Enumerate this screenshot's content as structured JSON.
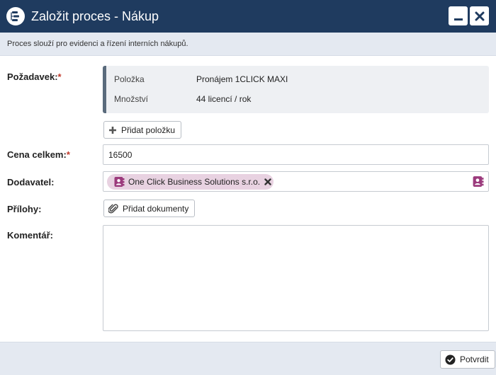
{
  "window": {
    "title": "Založit proces - Nákup",
    "icons": {
      "app": "process-icon",
      "minimize": "minimize-icon",
      "close": "close-icon"
    }
  },
  "description": "Proces slouží pro evidenci a řízení interních nákupů.",
  "form": {
    "pozadavek": {
      "label": "Požadavek:",
      "required_mark": "*",
      "rows": [
        {
          "key": "Položka",
          "value": "Pronájem 1CLICK MAXI"
        },
        {
          "key": "Množství",
          "value": "44 licencí / rok"
        }
      ],
      "add_item_button": "Přidat položku"
    },
    "cena": {
      "label": "Cena celkem:",
      "required_mark": "*",
      "value": "16500"
    },
    "dodavatel": {
      "label": "Dodavatel:",
      "chip_label": "One Click Business Solutions s.r.o."
    },
    "prilohy": {
      "label": "Přílohy:",
      "add_documents_button": "Přidat dokumenty"
    },
    "komentar": {
      "label": "Komentář:",
      "value": ""
    }
  },
  "footer": {
    "confirm_button": "Potvrdit"
  },
  "colors": {
    "titlebar": "#1f3b5f",
    "chip": "#e8d2e1",
    "contact_icon": "#9b3a7c",
    "required": "#c0392b"
  }
}
